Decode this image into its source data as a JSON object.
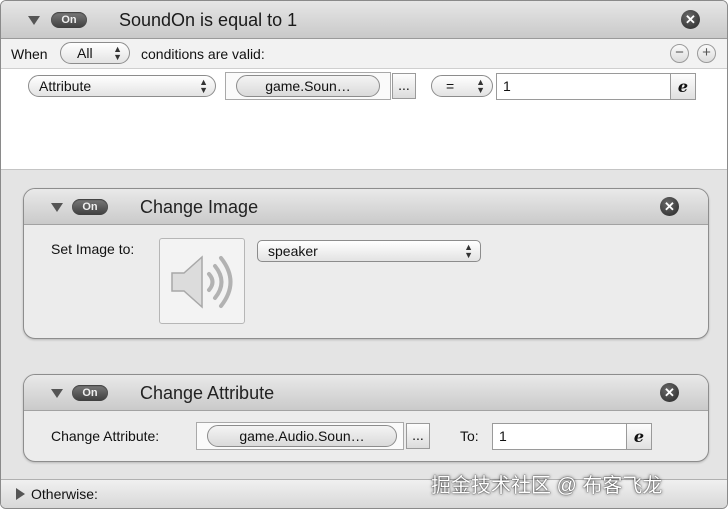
{
  "rule": {
    "on_label": "On",
    "title": "SoundOn is equal to 1",
    "close_glyph": "✕"
  },
  "when_row": {
    "prefix": "When",
    "mode_value": "All",
    "suffix": "conditions are valid:",
    "remove_glyph": "−",
    "add_glyph": "+"
  },
  "condition": {
    "type_value": "Attribute",
    "attribute_token": "game.Soun…",
    "browse_label": "...",
    "operator_value": "=",
    "compare_value": "1",
    "expression_label": "e"
  },
  "change_image": {
    "on_label": "On",
    "title": "Change Image",
    "close_glyph": "✕",
    "set_label": "Set Image to:",
    "image_value": "speaker",
    "image_icon": "speaker-icon"
  },
  "change_attribute": {
    "on_label": "On",
    "title": "Change Attribute",
    "close_glyph": "✕",
    "field_label": "Change Attribute:",
    "attribute_token": "game.Audio.Soun…",
    "browse_label": "...",
    "to_label": "To:",
    "to_value": "1",
    "expression_label": "e"
  },
  "otherwise": {
    "label": "Otherwise:"
  },
  "watermark": {
    "text": "掘金技术社区 @ 布客飞龙"
  },
  "colors": {
    "header_gradient_top": "#e6e6e6",
    "header_gradient_bottom": "#c9c9c9",
    "actions_background": "#e4e4e4",
    "on_pill": "#4a4a4a"
  }
}
